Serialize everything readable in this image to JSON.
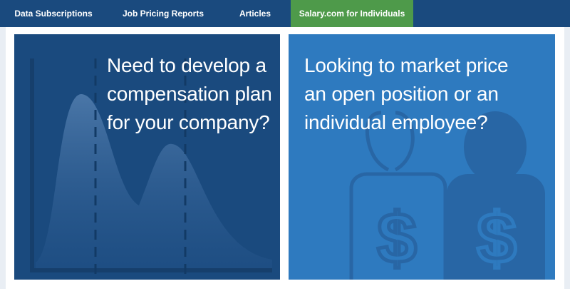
{
  "nav": {
    "items": [
      {
        "label": "Data Subscriptions",
        "active": false
      },
      {
        "label": "Job Pricing Reports",
        "active": false
      },
      {
        "label": "Articles",
        "active": false
      },
      {
        "label": "Salary.com for Individuals",
        "active": true
      }
    ]
  },
  "cards": {
    "left": {
      "lines": [
        "Need to develop a",
        "compensation plan",
        "for your company?"
      ],
      "icon": "bell-curve-chart-icon"
    },
    "right": {
      "lines": [
        "Looking to market price",
        "an open position or an",
        "individual employee?"
      ],
      "icon": "people-dollar-icon"
    }
  },
  "colors": {
    "nav_bg": "#1a4a7e",
    "nav_active": "#4e9a4a",
    "card_left_bg": "#1a4a7e",
    "card_right_bg": "#2e7abf"
  }
}
